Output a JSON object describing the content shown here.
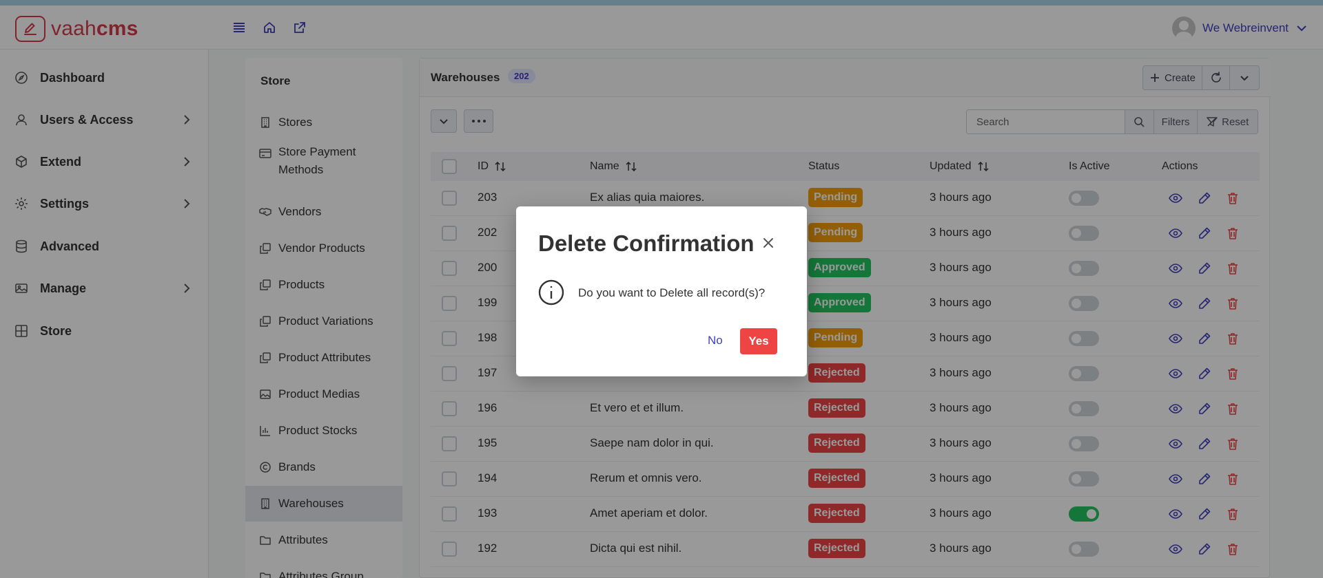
{
  "app": {
    "logo_light": "vaah",
    "logo_bold": "cms",
    "user_name": "We Webreinvent"
  },
  "sidebar": {
    "items": [
      {
        "label": "Dashboard",
        "icon": "compass-icon",
        "has_children": false
      },
      {
        "label": "Users & Access",
        "icon": "user-icon",
        "has_children": true
      },
      {
        "label": "Extend",
        "icon": "cube-icon",
        "has_children": true
      },
      {
        "label": "Settings",
        "icon": "gear-icon",
        "has_children": true
      },
      {
        "label": "Advanced",
        "icon": "database-icon",
        "has_children": false
      },
      {
        "label": "Manage",
        "icon": "images-icon",
        "has_children": true
      },
      {
        "label": "Store",
        "icon": "table-icon",
        "has_children": false
      }
    ]
  },
  "submenu": {
    "title": "Store",
    "items": [
      {
        "label": "Stores",
        "icon": "building-icon"
      },
      {
        "label": "Store Payment Methods",
        "label_line1": "Store Payment",
        "label_line2": "Methods",
        "icon": "credit-card-icon"
      },
      {
        "label": "Vendors",
        "icon": "handshake-icon"
      },
      {
        "label": "Vendor Products",
        "icon": "copy-icon"
      },
      {
        "label": "Products",
        "icon": "copy-icon"
      },
      {
        "label": "Product Variations",
        "icon": "copy-icon"
      },
      {
        "label": "Product Attributes",
        "icon": "copy-icon"
      },
      {
        "label": "Product Medias",
        "icon": "image-icon"
      },
      {
        "label": "Product Stocks",
        "icon": "chart-bar-icon"
      },
      {
        "label": "Brands",
        "icon": "copyright-icon"
      },
      {
        "label": "Warehouses",
        "icon": "building-icon",
        "active": true
      },
      {
        "label": "Attributes",
        "icon": "folder-icon"
      },
      {
        "label": "Attributes Group",
        "icon": "folder-icon"
      }
    ]
  },
  "panel": {
    "title": "Warehouses",
    "count": "202",
    "create_label": "Create",
    "search_placeholder": "Search",
    "filters_label": "Filters",
    "reset_label": "Reset"
  },
  "table": {
    "columns": {
      "id": "ID",
      "name": "Name",
      "status": "Status",
      "updated": "Updated",
      "is_active": "Is Active",
      "actions": "Actions"
    },
    "rows": [
      {
        "id": "203",
        "name": "Ex alias quia maiores.",
        "status": "Pending",
        "updated": "3 hours ago",
        "active": false
      },
      {
        "id": "202",
        "name": "",
        "status": "Pending",
        "updated": "3 hours ago",
        "active": false
      },
      {
        "id": "200",
        "name": "",
        "status": "Approved",
        "updated": "3 hours ago",
        "active": false
      },
      {
        "id": "199",
        "name": "",
        "status": "Approved",
        "updated": "3 hours ago",
        "active": false
      },
      {
        "id": "198",
        "name": "",
        "status": "Pending",
        "updated": "3 hours ago",
        "active": false
      },
      {
        "id": "197",
        "name": "",
        "status": "Rejected",
        "updated": "3 hours ago",
        "active": false
      },
      {
        "id": "196",
        "name": "Et vero et et illum.",
        "status": "Rejected",
        "updated": "3 hours ago",
        "active": false
      },
      {
        "id": "195",
        "name": "Saepe nam dolor in qui.",
        "status": "Rejected",
        "updated": "3 hours ago",
        "active": false
      },
      {
        "id": "194",
        "name": "Rerum et omnis vero.",
        "status": "Rejected",
        "updated": "3 hours ago",
        "active": false
      },
      {
        "id": "193",
        "name": "Amet aperiam et dolor.",
        "status": "Rejected",
        "updated": "3 hours ago",
        "active": true
      },
      {
        "id": "192",
        "name": "Dicta qui est nihil.",
        "status": "Rejected",
        "updated": "3 hours ago",
        "active": false
      }
    ]
  },
  "modal": {
    "title": "Delete Confirmation",
    "message": "Do you want to Delete all record(s)?",
    "no_label": "No",
    "yes_label": "Yes"
  },
  "colors": {
    "brand": "#d93a4c",
    "accent": "#3f3fbf",
    "pending": "#f59e0b",
    "approved": "#22c55e",
    "rejected": "#ef4444"
  }
}
